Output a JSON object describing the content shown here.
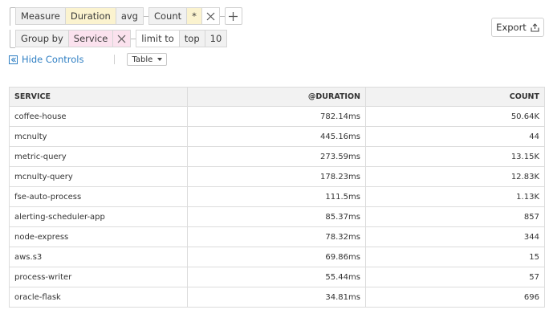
{
  "query": {
    "measure_label": "Measure",
    "measure_field": "Duration",
    "aggregation": "avg",
    "count_label": "Count",
    "count_value": "*",
    "group_by_label": "Group by",
    "group_by_field": "Service",
    "limit_label": "limit to",
    "limit_mode": "top",
    "limit_value": "10"
  },
  "toolbar": {
    "export_label": "Export",
    "hide_controls_label": "Hide Controls",
    "view_select_value": "Table"
  },
  "table": {
    "columns": [
      "SERVICE",
      "@DURATION",
      "COUNT"
    ],
    "rows": [
      {
        "service": "coffee-house",
        "duration": "782.14ms",
        "count": "50.64K"
      },
      {
        "service": "mcnulty",
        "duration": "445.16ms",
        "count": "44"
      },
      {
        "service": "metric-query",
        "duration": "273.59ms",
        "count": "13.15K"
      },
      {
        "service": "mcnulty-query",
        "duration": "178.23ms",
        "count": "12.83K"
      },
      {
        "service": "fse-auto-process",
        "duration": "111.5ms",
        "count": "1.13K"
      },
      {
        "service": "alerting-scheduler-app",
        "duration": "85.37ms",
        "count": "857"
      },
      {
        "service": "node-express",
        "duration": "78.32ms",
        "count": "344"
      },
      {
        "service": "aws.s3",
        "duration": "69.86ms",
        "count": "15"
      },
      {
        "service": "process-writer",
        "duration": "55.44ms",
        "count": "57"
      },
      {
        "service": "oracle-flask",
        "duration": "34.81ms",
        "count": "696"
      }
    ]
  },
  "colors": {
    "link": "#2f7fc3",
    "measure_highlight": "#fbf3cf",
    "groupby_highlight": "#fbe2ee"
  },
  "icons": [
    "close-icon",
    "plus-icon",
    "export-icon",
    "hide-controls-icon",
    "chevron-down-icon"
  ]
}
